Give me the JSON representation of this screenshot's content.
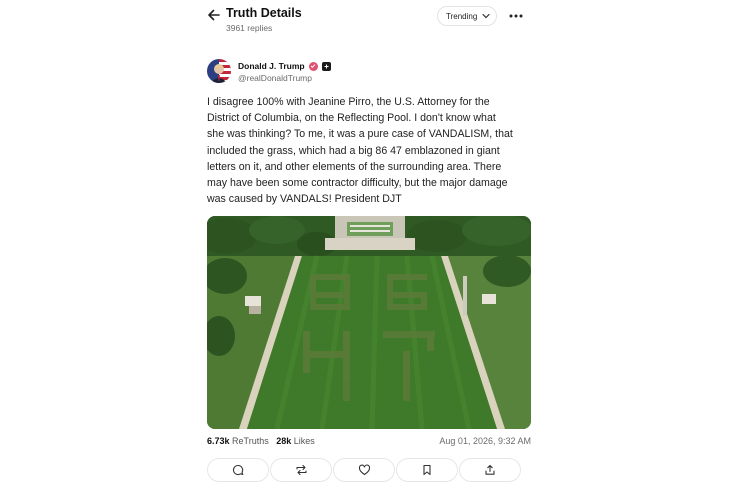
{
  "header": {
    "title": "Truth Details",
    "reply_count": "3961 replies",
    "sort_label": "Trending"
  },
  "author": {
    "name": "Donald J. Trump",
    "handle": "@realDonaldTrump"
  },
  "post": {
    "lines": [
      "I disagree 100% with Jeanine Pirro, the U.S. Attorney for the",
      "District of Columbia, on the Reflecting Pool. I don't know what",
      "she was thinking? To me, it was a pure case of VANDALISM, that",
      "included the grass, which had a big 86 47 emblazoned in giant",
      "letters on it, and other elements of the surrounding area. There",
      "may have been some contractor difficulty, but the major damage",
      "was caused by VANDALS! President DJT"
    ]
  },
  "stats": {
    "retruths_count": "6.73k",
    "retruths_label": "ReTruths",
    "likes_count": "28k",
    "likes_label": "Likes",
    "timestamp": "Aug 01, 2026, 9:32 AM"
  },
  "actions": [
    "reply-icon",
    "retruth-icon",
    "like-icon",
    "bookmark-icon",
    "share-icon"
  ],
  "colors": {
    "verified": "#e0506e",
    "text": "#1f1f1f",
    "muted": "#6b6b6b",
    "border": "#e6e6e6"
  }
}
